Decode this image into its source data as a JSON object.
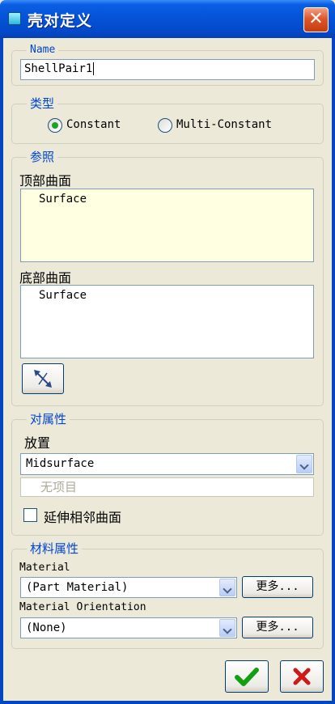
{
  "window": {
    "title": "壳对定义",
    "close": "✕"
  },
  "name_group": {
    "legend": "Name",
    "value": "ShellPair1"
  },
  "type_group": {
    "legend": "类型",
    "options": [
      {
        "label": "Constant",
        "selected": true
      },
      {
        "label": "Multi-Constant",
        "selected": false
      }
    ]
  },
  "reference_group": {
    "legend": "参照",
    "top_label": "顶部曲面",
    "top_value": "Surface",
    "bottom_label": "底部曲面",
    "bottom_value": "Surface",
    "flip_icon": "swap-arrows-icon"
  },
  "pair_props": {
    "legend": "对属性",
    "placement_label": "放置",
    "placement_value": "Midsurface",
    "items_value": "无项目",
    "extend_label": "延伸相邻曲面",
    "extend_checked": false
  },
  "material_props": {
    "legend": "材料属性",
    "material_label": "Material",
    "material_value": "(Part Material)",
    "more1": "更多...",
    "orientation_label": "Material Orientation",
    "orientation_value": "(None)",
    "more2": "更多..."
  },
  "actions": {
    "ok_icon": "checkmark-icon",
    "cancel_icon": "x-icon"
  }
}
